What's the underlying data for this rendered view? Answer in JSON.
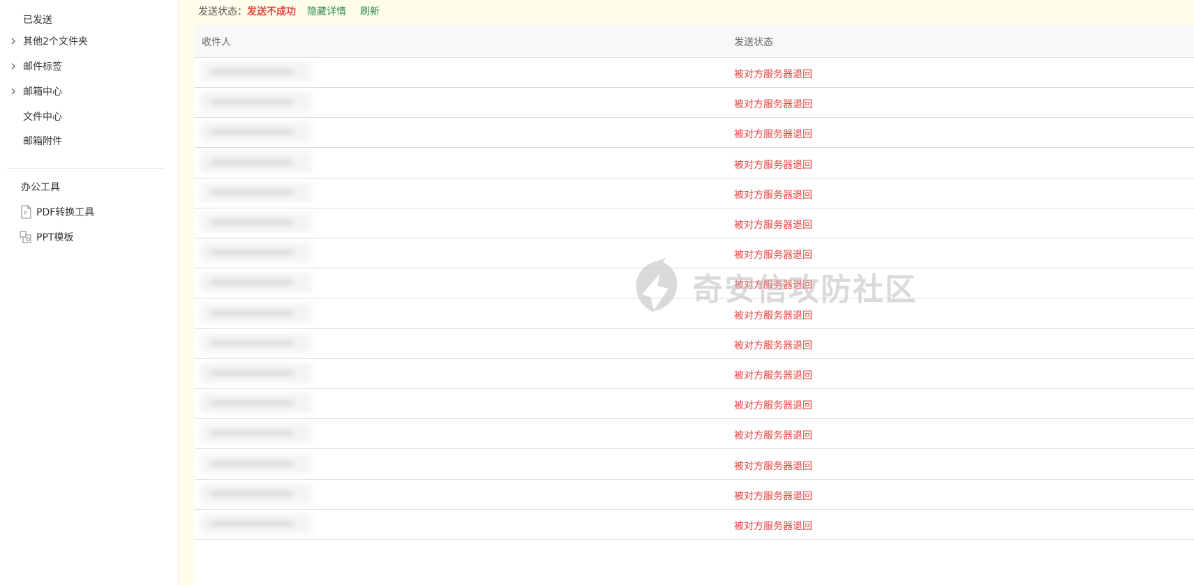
{
  "sidebar": {
    "items": [
      {
        "label": "已发送",
        "has_chevron": false
      },
      {
        "label": "其他2个文件夹",
        "has_chevron": true
      },
      {
        "label": "邮件标签",
        "has_chevron": true
      },
      {
        "label": "邮箱中心",
        "has_chevron": true
      },
      {
        "label": "文件中心",
        "has_chevron": false
      },
      {
        "label": "邮箱附件",
        "has_chevron": false
      }
    ],
    "tools_title": "办公工具",
    "tools": [
      {
        "label": "PDF转换工具",
        "icon": "pdf-file-icon"
      },
      {
        "label": "PPT模板",
        "icon": "ppt-template-icon"
      }
    ]
  },
  "status": {
    "label": "发送状态：",
    "value": "发送不成功",
    "hide_details": "隐藏详情",
    "refresh": "刷新"
  },
  "table": {
    "headers": {
      "recipient": "收件人",
      "status": "发送状态"
    },
    "rows": [
      {
        "status": "被对方服务器退回"
      },
      {
        "status": "被对方服务器退回"
      },
      {
        "status": "被对方服务器退回"
      },
      {
        "status": "被对方服务器退回"
      },
      {
        "status": "被对方服务器退回"
      },
      {
        "status": "被对方服务器退回"
      },
      {
        "status": "被对方服务器退回"
      },
      {
        "status": "被对方服务器退回"
      },
      {
        "status": "被对方服务器退回"
      },
      {
        "status": "被对方服务器退回"
      },
      {
        "status": "被对方服务器退回"
      },
      {
        "status": "被对方服务器退回"
      },
      {
        "status": "被对方服务器退回"
      },
      {
        "status": "被对方服务器退回"
      },
      {
        "status": "被对方服务器退回"
      },
      {
        "status": "被对方服务器退回"
      }
    ]
  },
  "watermark": {
    "text": "奇安信攻防社区",
    "icon": "lightning-logo-icon"
  },
  "colors": {
    "error_red": "#e64340",
    "link_green": "#2e8b57",
    "main_bg": "#fefcea"
  }
}
